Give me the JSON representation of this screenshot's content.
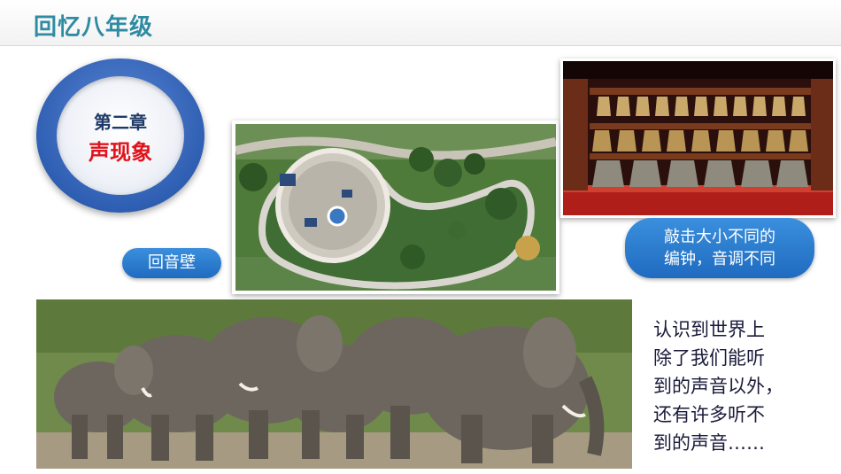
{
  "header": {
    "title": "回忆八年级"
  },
  "chapter": {
    "number": "第二章",
    "name": "声现象"
  },
  "labels": {
    "echo_wall": "回音壁",
    "bells_line1": "敲击大小不同的",
    "bells_line2": "编钟，音调不同"
  },
  "caption": {
    "lines": [
      "认识到世界上",
      "除了我们能听",
      "到的声音以外，",
      "还有许多听不",
      "到的声音……"
    ]
  },
  "colors": {
    "title": "#2f8ba2",
    "accent_red": "#e0141c",
    "pill_blue": "#1f6bc0"
  }
}
